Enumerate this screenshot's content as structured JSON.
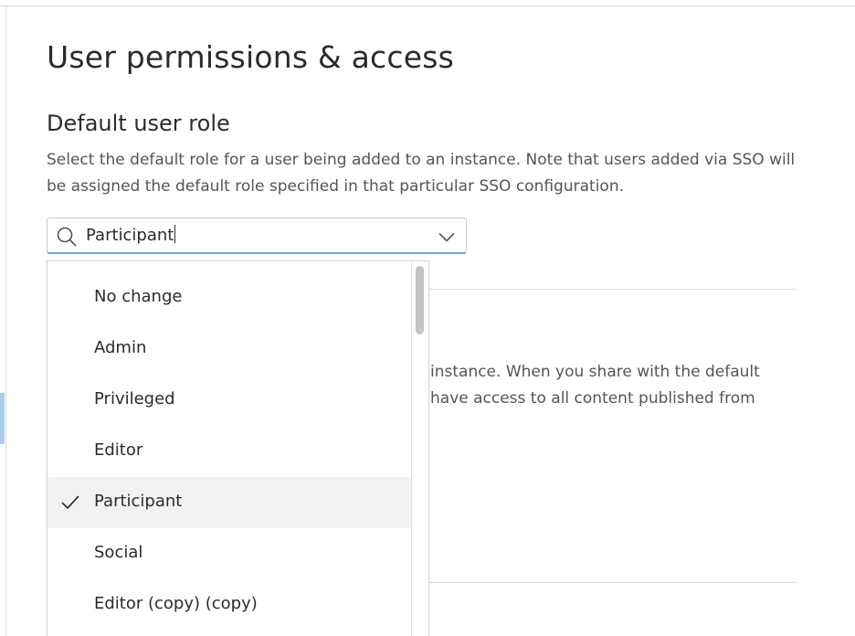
{
  "page": {
    "title": "User permissions & access"
  },
  "default_role_section": {
    "heading": "Default user role",
    "description": "Select the default role for a user being added to an instance. Note that users added via SSO will be assigned the default role specified in that particular SSO configuration."
  },
  "role_select": {
    "value": "Participant",
    "search_icon": "search-icon",
    "toggle_icon": "chevron-down-icon",
    "options": [
      {
        "label": "No change",
        "selected": false
      },
      {
        "label": "Admin",
        "selected": false
      },
      {
        "label": "Privileged",
        "selected": false
      },
      {
        "label": "Editor",
        "selected": false
      },
      {
        "label": "Participant",
        "selected": true
      },
      {
        "label": "Social",
        "selected": false
      },
      {
        "label": "Editor (copy) (copy)",
        "selected": false
      }
    ]
  },
  "background_section": {
    "partial_line_1": "instance. When you share with the default",
    "partial_line_2": "have access to all content published from"
  },
  "colors": {
    "focus_underline": "#6aa6e0",
    "selected_row": "#f2f2f2",
    "side_accent": "#a9cdee"
  }
}
